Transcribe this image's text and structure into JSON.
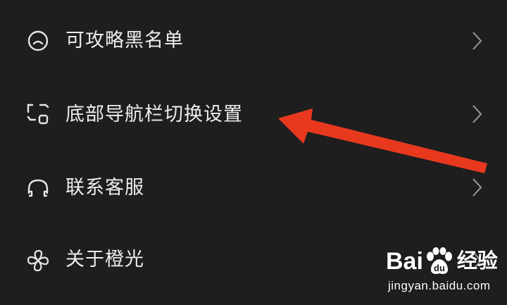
{
  "menu": {
    "items": [
      {
        "label": "可攻略黑名单",
        "icon": "blacklist-face-icon"
      },
      {
        "label": "底部导航栏切换设置",
        "icon": "switch-nav-icon"
      },
      {
        "label": "联系客服",
        "icon": "headset-icon"
      },
      {
        "label": "关于橙光",
        "icon": "pinwheel-icon"
      }
    ]
  },
  "annotation": {
    "arrow_color": "#e8391f"
  },
  "watermark": {
    "brand_left": "Bai",
    "brand_right": "du",
    "suffix": "经验",
    "url": "jingyan.baidu.com"
  },
  "colors": {
    "background": "#1e1e1e",
    "text": "#ececec",
    "icon": "#e6e6e6",
    "chevron": "#9a9a9a"
  }
}
